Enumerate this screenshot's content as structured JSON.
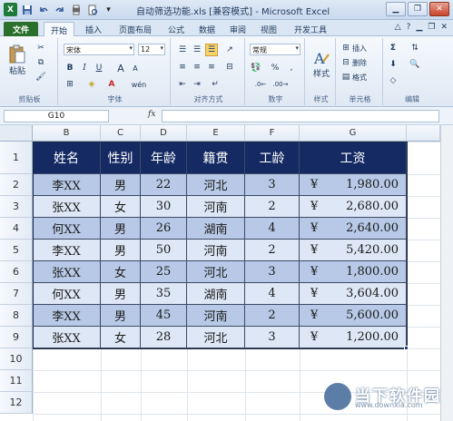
{
  "window": {
    "title": "自动筛选功能.xls [兼容模式] - Microsoft Excel",
    "logo": "X",
    "qat_icons": [
      "save-icon",
      "undo-icon",
      "redo-icon",
      "print-preview-icon",
      "print-icon",
      "customize-qat-icon"
    ]
  },
  "tabs": [
    "文件",
    "开始",
    "插入",
    "页面布局",
    "公式",
    "数据",
    "审阅",
    "视图",
    "开发工具"
  ],
  "ribbon": {
    "clipboard": {
      "label": "剪贴板",
      "paste": "粘贴"
    },
    "font": {
      "label": "字体",
      "name": "宋体",
      "size": "12",
      "bold": "B",
      "italic": "I",
      "underline": "U",
      "grow": "A",
      "shrink": "A",
      "pinyin": "wén"
    },
    "alignment": {
      "label": "对齐方式"
    },
    "number": {
      "label": "数字",
      "format": "常规",
      "percent": "%",
      "comma": ","
    },
    "styles": {
      "label": "样式",
      "button": "样式"
    },
    "cells": {
      "label": "单元格",
      "insert": "插入",
      "delete": "删除",
      "format": "格式"
    },
    "editing": {
      "label": "编辑",
      "sum": "Σ"
    }
  },
  "formula_bar": {
    "name_box": "G10",
    "fx": "fx",
    "content": ""
  },
  "columns": [
    "B",
    "C",
    "D",
    "E",
    "F",
    "G"
  ],
  "rows": [
    "1",
    "2",
    "3",
    "4",
    "5",
    "6",
    "7",
    "8",
    "9",
    "10",
    "11",
    "12"
  ],
  "table": {
    "headers": [
      "姓名",
      "性别",
      "年龄",
      "籍贯",
      "工龄",
      "工资"
    ],
    "currency": "¥",
    "rows": [
      [
        "李XX",
        "男",
        "22",
        "河北",
        "3",
        "1,980.00"
      ],
      [
        "张XX",
        "女",
        "30",
        "河南",
        "2",
        "2,680.00"
      ],
      [
        "何XX",
        "男",
        "26",
        "湖南",
        "4",
        "2,640.00"
      ],
      [
        "李XX",
        "男",
        "50",
        "河南",
        "2",
        "5,420.00"
      ],
      [
        "张XX",
        "女",
        "25",
        "河北",
        "3",
        "1,800.00"
      ],
      [
        "何XX",
        "男",
        "35",
        "湖南",
        "4",
        "3,604.00"
      ],
      [
        "李XX",
        "男",
        "45",
        "河南",
        "2",
        "5,600.00"
      ],
      [
        "张XX",
        "女",
        "28",
        "河北",
        "3",
        "1,200.00"
      ]
    ]
  },
  "watermark": {
    "title": "当下软件园",
    "url": "www.downxia.com"
  },
  "colors": {
    "header_fill": "#152a63",
    "row_dark": "#b7c9e6",
    "row_light": "#dde7f5",
    "file_tab": "#2a6f2c"
  }
}
